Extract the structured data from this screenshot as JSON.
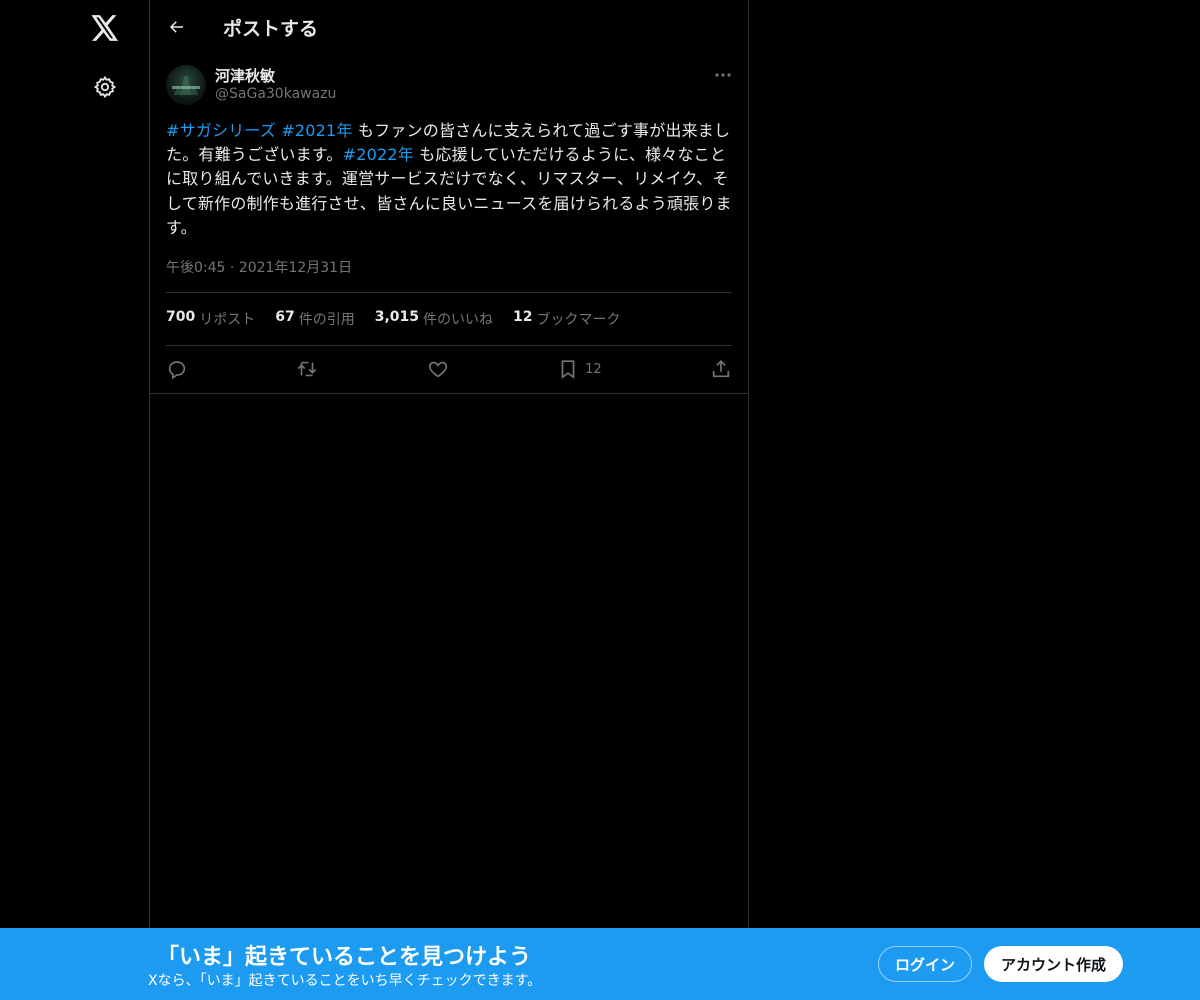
{
  "header": {
    "title": "ポストする"
  },
  "post": {
    "author_name": "河津秋敏",
    "author_handle": "@SaGa30kawazu",
    "text_parts": [
      "#サガシリーズ",
      " ",
      "#2021年",
      " もファンの皆さんに支えられて過ごす事が出来ました。有難うございます。",
      "#2022年",
      " も応援していただけるように、様々なことに取り組んでいきます。運営サービスだけでなく、リマスター、リメイク、そして新作の制作も進行させ、皆さんに良いニュースを届けられるよう頑張ります。"
    ],
    "time": "午後0:45",
    "separator": "·",
    "date": "2021年12月31日"
  },
  "stats": [
    {
      "num": "700",
      "label": "リポスト"
    },
    {
      "num": "67",
      "label": "件の引用"
    },
    {
      "num": "3,015",
      "label": "件のいいね"
    },
    {
      "num": "12",
      "label": "ブックマーク"
    }
  ],
  "actions": {
    "bookmark_count": "12"
  },
  "banner": {
    "title": "「いま」起きていることを見つけよう",
    "subtitle": "Xなら、「いま」起きていることをいち早くチェックできます。",
    "login_label": "ログイン",
    "signup_label": "アカウント作成"
  },
  "colors": {
    "accent": "#1d9bf0",
    "text": "#e7e9ea",
    "muted": "#71767b",
    "border": "#2f3336",
    "background": "#000000"
  },
  "icons": [
    "x-logo-icon",
    "gear-icon",
    "back-arrow-icon",
    "more-icon",
    "reply-icon",
    "repost-icon",
    "like-icon",
    "bookmark-icon",
    "share-icon"
  ]
}
